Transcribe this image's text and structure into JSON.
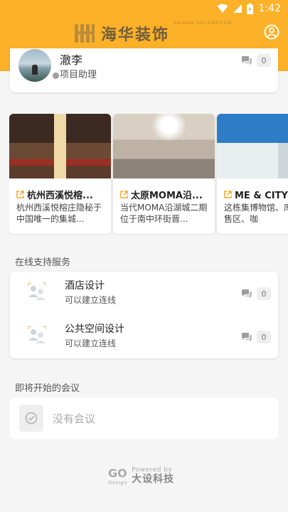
{
  "status_bar": {
    "time": "1:42"
  },
  "header": {
    "logo_text": "海华装饰",
    "logo_subtext": "HAIHUA DECORATION",
    "profile_icon": "account-circle-icon"
  },
  "user": {
    "name": "澈李",
    "role": "项目助理",
    "message_count": "0"
  },
  "projects": [
    {
      "title": "杭州西溪悦榕...",
      "desc": "杭州西溪悦榕庄隐秘于中国唯一的集城..."
    },
    {
      "title": "太原MOMA沿...",
      "desc": "当代MOMA沿湖城二期位于南中环街晋..."
    },
    {
      "title": "ME & CITY设",
      "desc": "这栋集博物馆、库、零售区、咖"
    }
  ],
  "services": {
    "section_title": "在线支持服务",
    "items": [
      {
        "name": "酒店设计",
        "subtitle": "可以建立连线",
        "count": "0"
      },
      {
        "name": "公共空间设计",
        "subtitle": "可以建立连线",
        "count": "0"
      }
    ]
  },
  "meetings": {
    "section_title": "即将开始的会议",
    "empty_text": "没有会议"
  },
  "footer": {
    "go": "GO",
    "design": "Design",
    "powered_by": "Powered by",
    "brand": "大设科技"
  },
  "colors": {
    "header_bg": "#fcb129",
    "link_icon": "#f5a623"
  }
}
